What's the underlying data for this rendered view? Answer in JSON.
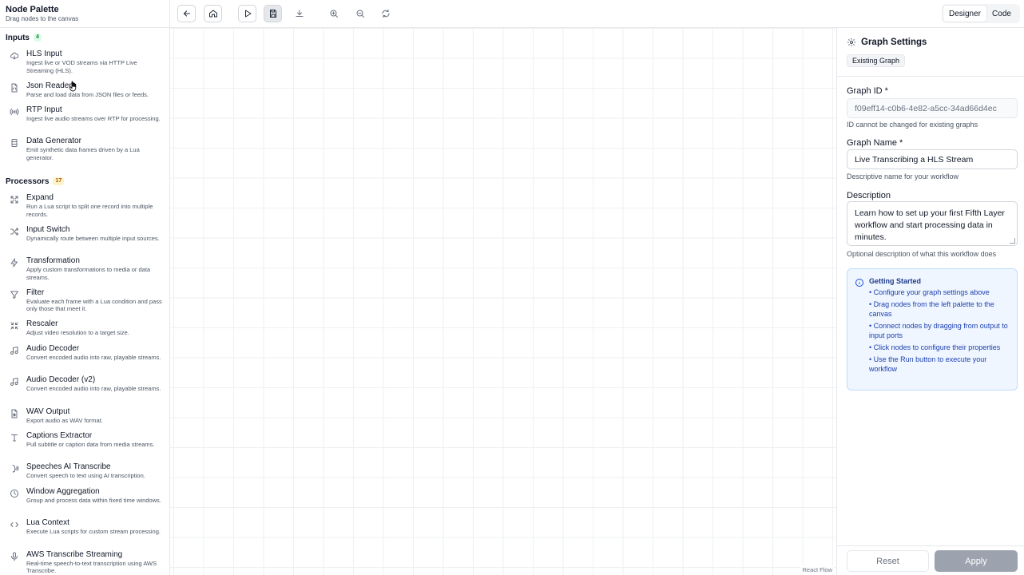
{
  "palette": {
    "title": "Node Palette",
    "subtitle": "Drag nodes to the canvas",
    "inputs": {
      "label": "Inputs",
      "count": "4",
      "items": [
        {
          "name": "HLS Input",
          "desc": "Ingest live or VOD streams via HTTP Live Streaming (HLS).",
          "icon": "cloud-download-icon"
        },
        {
          "name": "Json Reader",
          "desc": "Parse and load data from JSON files or feeds.",
          "icon": "file-json-icon"
        },
        {
          "name": "RTP Input",
          "desc": "Ingest live audio streams over RTP for processing.",
          "icon": "radio-icon"
        },
        {
          "name": "Data Generator",
          "desc": "Emit synthetic data frames driven by a Lua generator.",
          "icon": "database-icon"
        }
      ]
    },
    "processors": {
      "label": "Processors",
      "count": "17",
      "items": [
        {
          "name": "Expand",
          "desc": "Run a Lua script to split one record into multiple records.",
          "icon": "expand-icon"
        },
        {
          "name": "Input Switch",
          "desc": "Dynamically route between multiple input sources.",
          "icon": "shuffle-icon"
        },
        {
          "name": "Transformation",
          "desc": "Apply custom transformations to media or data streams.",
          "icon": "zap-icon"
        },
        {
          "name": "Filter",
          "desc": "Evaluate each frame with a Lua condition and pass only those that meet it.",
          "icon": "filter-icon"
        },
        {
          "name": "Rescaler",
          "desc": "Adjust video resolution to a target size.",
          "icon": "shrink-icon"
        },
        {
          "name": "Audio Decoder",
          "desc": "Convert encoded audio into raw, playable streams.",
          "icon": "music-icon"
        },
        {
          "name": "Audio Decoder (v2)",
          "desc": "Convert encoded audio into raw, playable streams.",
          "icon": "music-icon"
        },
        {
          "name": "WAV Output",
          "desc": "Export audio as WAV format.",
          "icon": "file-audio-icon"
        },
        {
          "name": "Captions Extractor",
          "desc": "Pull subtitle or caption data from media streams.",
          "icon": "type-icon"
        },
        {
          "name": "Speeches AI Transcribe",
          "desc": "Convert speech to text using AI transcription.",
          "icon": "speech-icon"
        },
        {
          "name": "Window Aggregation",
          "desc": "Group and process data within fixed time windows.",
          "icon": "clock-icon"
        },
        {
          "name": "Lua Context",
          "desc": "Execute Lua scripts for custom stream processing.",
          "icon": "code-icon"
        },
        {
          "name": "AWS Transcribe Streaming",
          "desc": "Real-time speech-to-text transcription using AWS Transcribe.",
          "icon": "mic-icon"
        }
      ]
    }
  },
  "toolbar": {
    "modes": {
      "designer": "Designer",
      "code": "Code",
      "active": "designer"
    }
  },
  "canvas": {
    "attribution": "React Flow"
  },
  "settings": {
    "title": "Graph Settings",
    "badge": "Existing Graph",
    "graph_id": {
      "label": "Graph ID *",
      "value": "f09eff14-c0b6-4e82-a5cc-34ad66d4ec",
      "help": "ID cannot be changed for existing graphs"
    },
    "graph_name": {
      "label": "Graph Name *",
      "value": "Live Transcribing a HLS Stream",
      "help": "Descriptive name for your workflow"
    },
    "description": {
      "label": "Description",
      "value": "Learn how to set up your first Fifth Layer workflow and start processing data in minutes.",
      "help": "Optional description of what this workflow does"
    },
    "getting_started": {
      "title": "Getting Started",
      "items": [
        "• Configure your graph settings above",
        "• Drag nodes from the left palette to the canvas",
        "• Connect nodes by dragging from output to input ports",
        "• Click nodes to configure their properties",
        "• Use the Run button to execute your workflow"
      ]
    },
    "reset_label": "Reset",
    "apply_label": "Apply"
  },
  "colors": {
    "inputs_badge": "#dcfce7",
    "processors_badge": "#fef3c7",
    "info_bg": "#eff6ff",
    "apply_bg": "#9ca3af"
  }
}
